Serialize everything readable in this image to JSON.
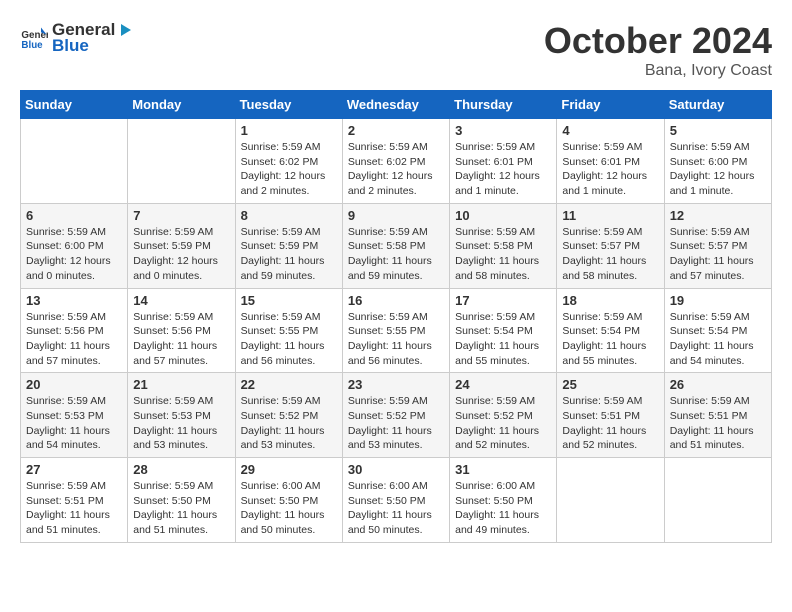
{
  "header": {
    "logo": {
      "text_general": "General",
      "text_blue": "Blue",
      "icon": "▶"
    },
    "title": "October 2024",
    "location": "Bana, Ivory Coast"
  },
  "calendar": {
    "weekdays": [
      "Sunday",
      "Monday",
      "Tuesday",
      "Wednesday",
      "Thursday",
      "Friday",
      "Saturday"
    ],
    "rows": [
      [
        {
          "day": "",
          "info": ""
        },
        {
          "day": "",
          "info": ""
        },
        {
          "day": "1",
          "info": "Sunrise: 5:59 AM\nSunset: 6:02 PM\nDaylight: 12 hours and 2 minutes."
        },
        {
          "day": "2",
          "info": "Sunrise: 5:59 AM\nSunset: 6:02 PM\nDaylight: 12 hours and 2 minutes."
        },
        {
          "day": "3",
          "info": "Sunrise: 5:59 AM\nSunset: 6:01 PM\nDaylight: 12 hours and 1 minute."
        },
        {
          "day": "4",
          "info": "Sunrise: 5:59 AM\nSunset: 6:01 PM\nDaylight: 12 hours and 1 minute."
        },
        {
          "day": "5",
          "info": "Sunrise: 5:59 AM\nSunset: 6:00 PM\nDaylight: 12 hours and 1 minute."
        }
      ],
      [
        {
          "day": "6",
          "info": "Sunrise: 5:59 AM\nSunset: 6:00 PM\nDaylight: 12 hours and 0 minutes."
        },
        {
          "day": "7",
          "info": "Sunrise: 5:59 AM\nSunset: 5:59 PM\nDaylight: 12 hours and 0 minutes."
        },
        {
          "day": "8",
          "info": "Sunrise: 5:59 AM\nSunset: 5:59 PM\nDaylight: 11 hours and 59 minutes."
        },
        {
          "day": "9",
          "info": "Sunrise: 5:59 AM\nSunset: 5:58 PM\nDaylight: 11 hours and 59 minutes."
        },
        {
          "day": "10",
          "info": "Sunrise: 5:59 AM\nSunset: 5:58 PM\nDaylight: 11 hours and 58 minutes."
        },
        {
          "day": "11",
          "info": "Sunrise: 5:59 AM\nSunset: 5:57 PM\nDaylight: 11 hours and 58 minutes."
        },
        {
          "day": "12",
          "info": "Sunrise: 5:59 AM\nSunset: 5:57 PM\nDaylight: 11 hours and 57 minutes."
        }
      ],
      [
        {
          "day": "13",
          "info": "Sunrise: 5:59 AM\nSunset: 5:56 PM\nDaylight: 11 hours and 57 minutes."
        },
        {
          "day": "14",
          "info": "Sunrise: 5:59 AM\nSunset: 5:56 PM\nDaylight: 11 hours and 57 minutes."
        },
        {
          "day": "15",
          "info": "Sunrise: 5:59 AM\nSunset: 5:55 PM\nDaylight: 11 hours and 56 minutes."
        },
        {
          "day": "16",
          "info": "Sunrise: 5:59 AM\nSunset: 5:55 PM\nDaylight: 11 hours and 56 minutes."
        },
        {
          "day": "17",
          "info": "Sunrise: 5:59 AM\nSunset: 5:54 PM\nDaylight: 11 hours and 55 minutes."
        },
        {
          "day": "18",
          "info": "Sunrise: 5:59 AM\nSunset: 5:54 PM\nDaylight: 11 hours and 55 minutes."
        },
        {
          "day": "19",
          "info": "Sunrise: 5:59 AM\nSunset: 5:54 PM\nDaylight: 11 hours and 54 minutes."
        }
      ],
      [
        {
          "day": "20",
          "info": "Sunrise: 5:59 AM\nSunset: 5:53 PM\nDaylight: 11 hours and 54 minutes."
        },
        {
          "day": "21",
          "info": "Sunrise: 5:59 AM\nSunset: 5:53 PM\nDaylight: 11 hours and 53 minutes."
        },
        {
          "day": "22",
          "info": "Sunrise: 5:59 AM\nSunset: 5:52 PM\nDaylight: 11 hours and 53 minutes."
        },
        {
          "day": "23",
          "info": "Sunrise: 5:59 AM\nSunset: 5:52 PM\nDaylight: 11 hours and 53 minutes."
        },
        {
          "day": "24",
          "info": "Sunrise: 5:59 AM\nSunset: 5:52 PM\nDaylight: 11 hours and 52 minutes."
        },
        {
          "day": "25",
          "info": "Sunrise: 5:59 AM\nSunset: 5:51 PM\nDaylight: 11 hours and 52 minutes."
        },
        {
          "day": "26",
          "info": "Sunrise: 5:59 AM\nSunset: 5:51 PM\nDaylight: 11 hours and 51 minutes."
        }
      ],
      [
        {
          "day": "27",
          "info": "Sunrise: 5:59 AM\nSunset: 5:51 PM\nDaylight: 11 hours and 51 minutes."
        },
        {
          "day": "28",
          "info": "Sunrise: 5:59 AM\nSunset: 5:50 PM\nDaylight: 11 hours and 51 minutes."
        },
        {
          "day": "29",
          "info": "Sunrise: 6:00 AM\nSunset: 5:50 PM\nDaylight: 11 hours and 50 minutes."
        },
        {
          "day": "30",
          "info": "Sunrise: 6:00 AM\nSunset: 5:50 PM\nDaylight: 11 hours and 50 minutes."
        },
        {
          "day": "31",
          "info": "Sunrise: 6:00 AM\nSunset: 5:50 PM\nDaylight: 11 hours and 49 minutes."
        },
        {
          "day": "",
          "info": ""
        },
        {
          "day": "",
          "info": ""
        }
      ]
    ]
  }
}
